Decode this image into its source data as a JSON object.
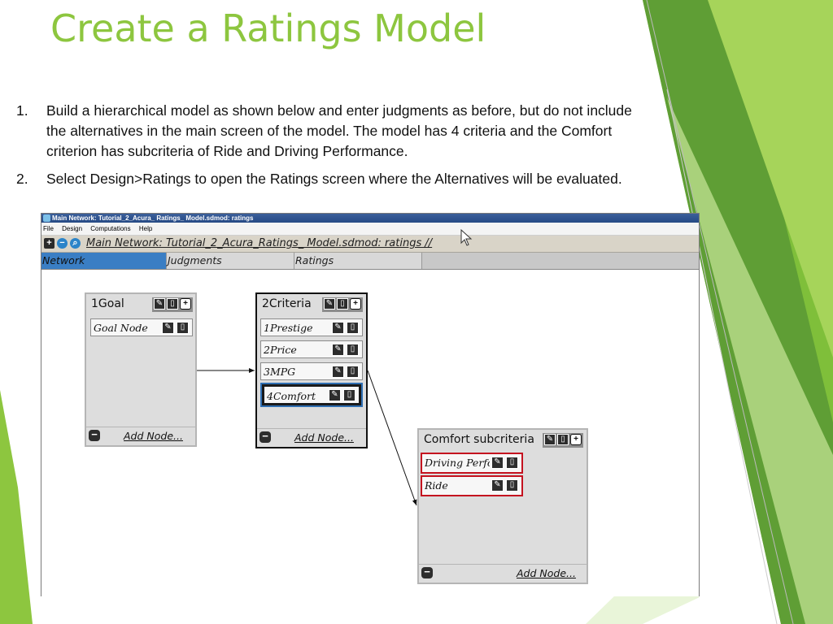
{
  "slide": {
    "title": "Create a Ratings Model",
    "steps": [
      {
        "num": "1.",
        "text": "Build a hierarchical model as shown below and enter judgments as before, but do not include the alternatives in the main screen of the model.  The model has 4 criteria and the Comfort criterion has subcriteria of Ride and Driving Performance."
      },
      {
        "num": "2.",
        "text": "Select Design>Ratings to open the Ratings screen where the Alternatives will be evaluated."
      }
    ],
    "colors": {
      "title": "#8dc63f",
      "accent_green": "#8dc63f"
    }
  },
  "app": {
    "window_title": "Main Network: Tutorial_2_Acura_ Ratings_ Model.sdmod: ratings",
    "menu": [
      "File",
      "Design",
      "Computations",
      "Help"
    ],
    "breadcrumb": "Main Network: Tutorial_2_Acura_Ratings_ Model.sdmod: ratings //",
    "tabs": [
      {
        "label": "Network",
        "active": true
      },
      {
        "label": "Judgments",
        "active": false
      },
      {
        "label": "Ratings",
        "active": false
      }
    ],
    "icons": {
      "edit": "pencil-icon",
      "delete": "trash-icon",
      "add": "plus-icon",
      "collapse": "minus-icon"
    },
    "clusters": {
      "goal": {
        "title": "1Goal",
        "add_label": "Add Node...",
        "nodes": [
          "Goal Node"
        ]
      },
      "criteria": {
        "title": "2Criteria",
        "add_label": "Add Node...",
        "nodes": [
          "1Prestige",
          "2Price",
          "3MPG",
          "4Comfort"
        ]
      },
      "comfort": {
        "title": "Comfort subcriteria",
        "add_label": "Add Node...",
        "nodes": [
          "Driving Perfor",
          "Ride"
        ]
      }
    },
    "colors": {
      "active_tab": "#3a7ec4",
      "highlight_red": "#c4121f",
      "selected_blue": "#2f6fb3"
    }
  }
}
